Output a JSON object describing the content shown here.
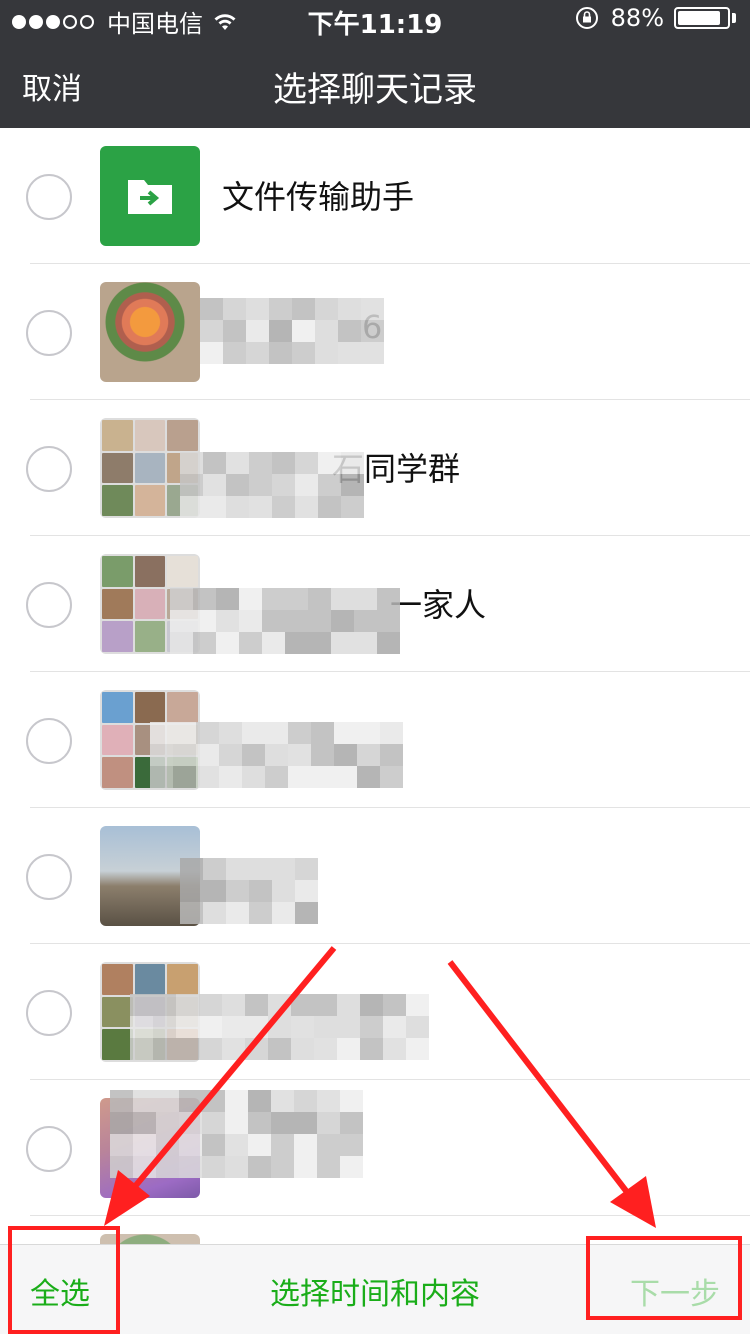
{
  "status_bar": {
    "carrier": "中国电信",
    "time": "下午11:19",
    "battery": "88%",
    "battery_level": 0.88
  },
  "nav": {
    "cancel": "取消",
    "title": "选择聊天记录"
  },
  "chats": [
    {
      "name": "文件传输助手",
      "avatar": "folder-icon"
    },
    {
      "name": "6",
      "avatar": "photo"
    },
    {
      "name": "石同学群",
      "avatar": "group"
    },
    {
      "name": "一家人",
      "avatar": "group"
    },
    {
      "name": "",
      "avatar": "group"
    },
    {
      "name": "",
      "avatar": "photo"
    },
    {
      "name": "",
      "avatar": "group"
    },
    {
      "name": "",
      "avatar": "photo"
    }
  ],
  "bottom_bar": {
    "select_all": "全选",
    "choose_time_content": "选择时间和内容",
    "next_step": "下一步"
  },
  "colors": {
    "nav_bg": "#36373b",
    "accent_green": "#1aad19",
    "disabled_green": "#a9dca9",
    "annotation_red": "#ff2020"
  }
}
